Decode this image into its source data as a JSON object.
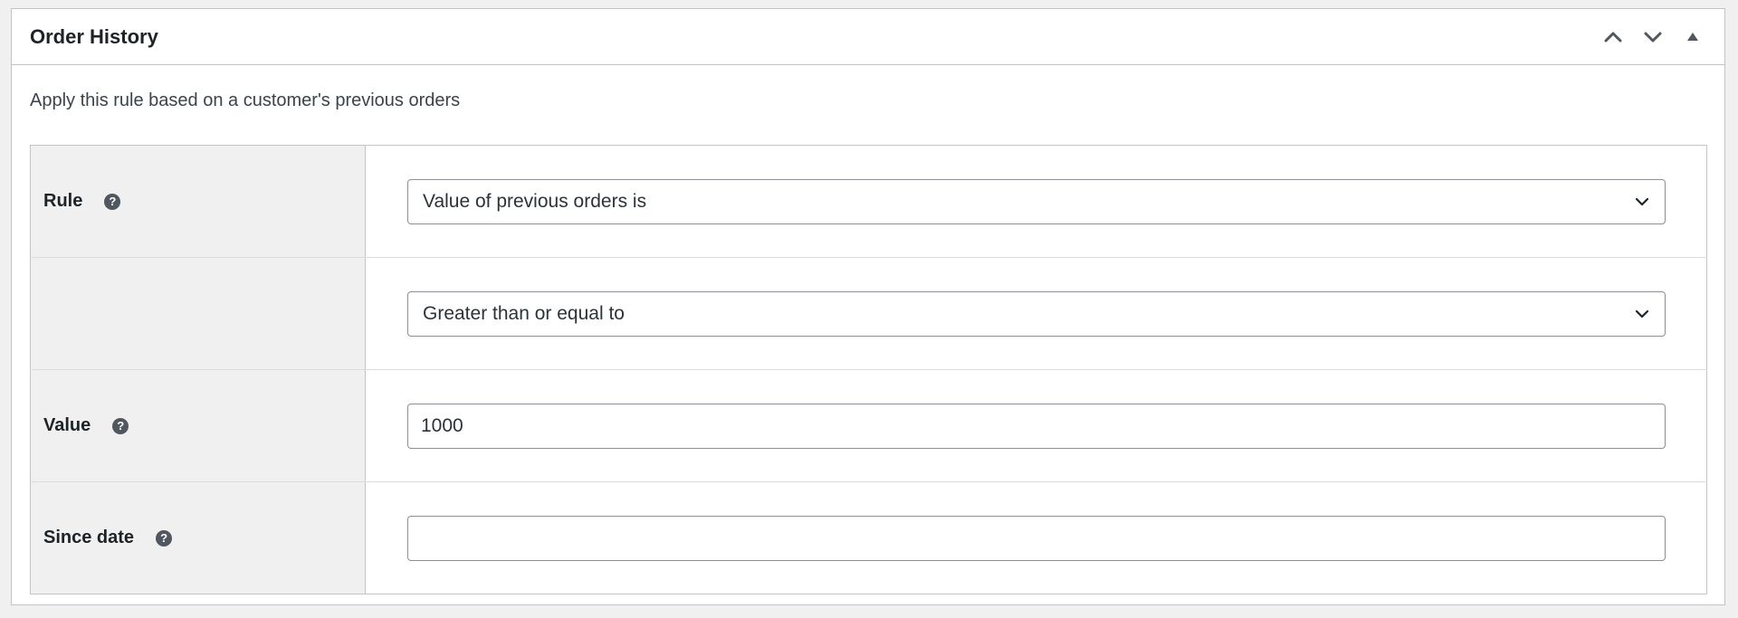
{
  "postbox": {
    "title": "Order History",
    "actions": {
      "move_up": "chevron-up-icon",
      "move_down": "chevron-down-icon",
      "toggle": "triangle-up-icon"
    }
  },
  "description": "Apply this rule based on a customer's previous orders",
  "rows": {
    "rule": {
      "label": "Rule",
      "help": "?",
      "selected": "Value of previous orders is"
    },
    "operator": {
      "selected": "Greater than or equal to"
    },
    "value": {
      "label": "Value",
      "help": "?",
      "input_value": "1000"
    },
    "since_date": {
      "label": "Since date",
      "help": "?",
      "input_value": ""
    }
  },
  "colors": {
    "border": "#c3c4c7",
    "label_bg": "#f0f0f1",
    "text": "#1d2327",
    "icon": "#50575e"
  }
}
